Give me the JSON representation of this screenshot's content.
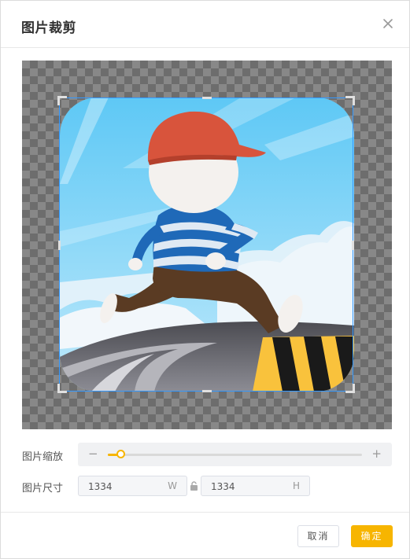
{
  "dialog": {
    "title": "图片裁剪",
    "close_icon": "close-icon"
  },
  "zoom": {
    "label": "图片缩放",
    "minus": "−",
    "plus": "+",
    "level": 0.05,
    "accent_color": "#f7b500"
  },
  "size": {
    "label": "图片尺寸",
    "width_value": "1334",
    "width_unit": "W",
    "height_value": "1334",
    "height_unit": "H",
    "lock_icon": "lock-icon"
  },
  "buttons": {
    "cancel": "取消",
    "ok": "确定"
  },
  "colors": {
    "accent": "#f7b500",
    "crop_border": "#3399ff"
  }
}
